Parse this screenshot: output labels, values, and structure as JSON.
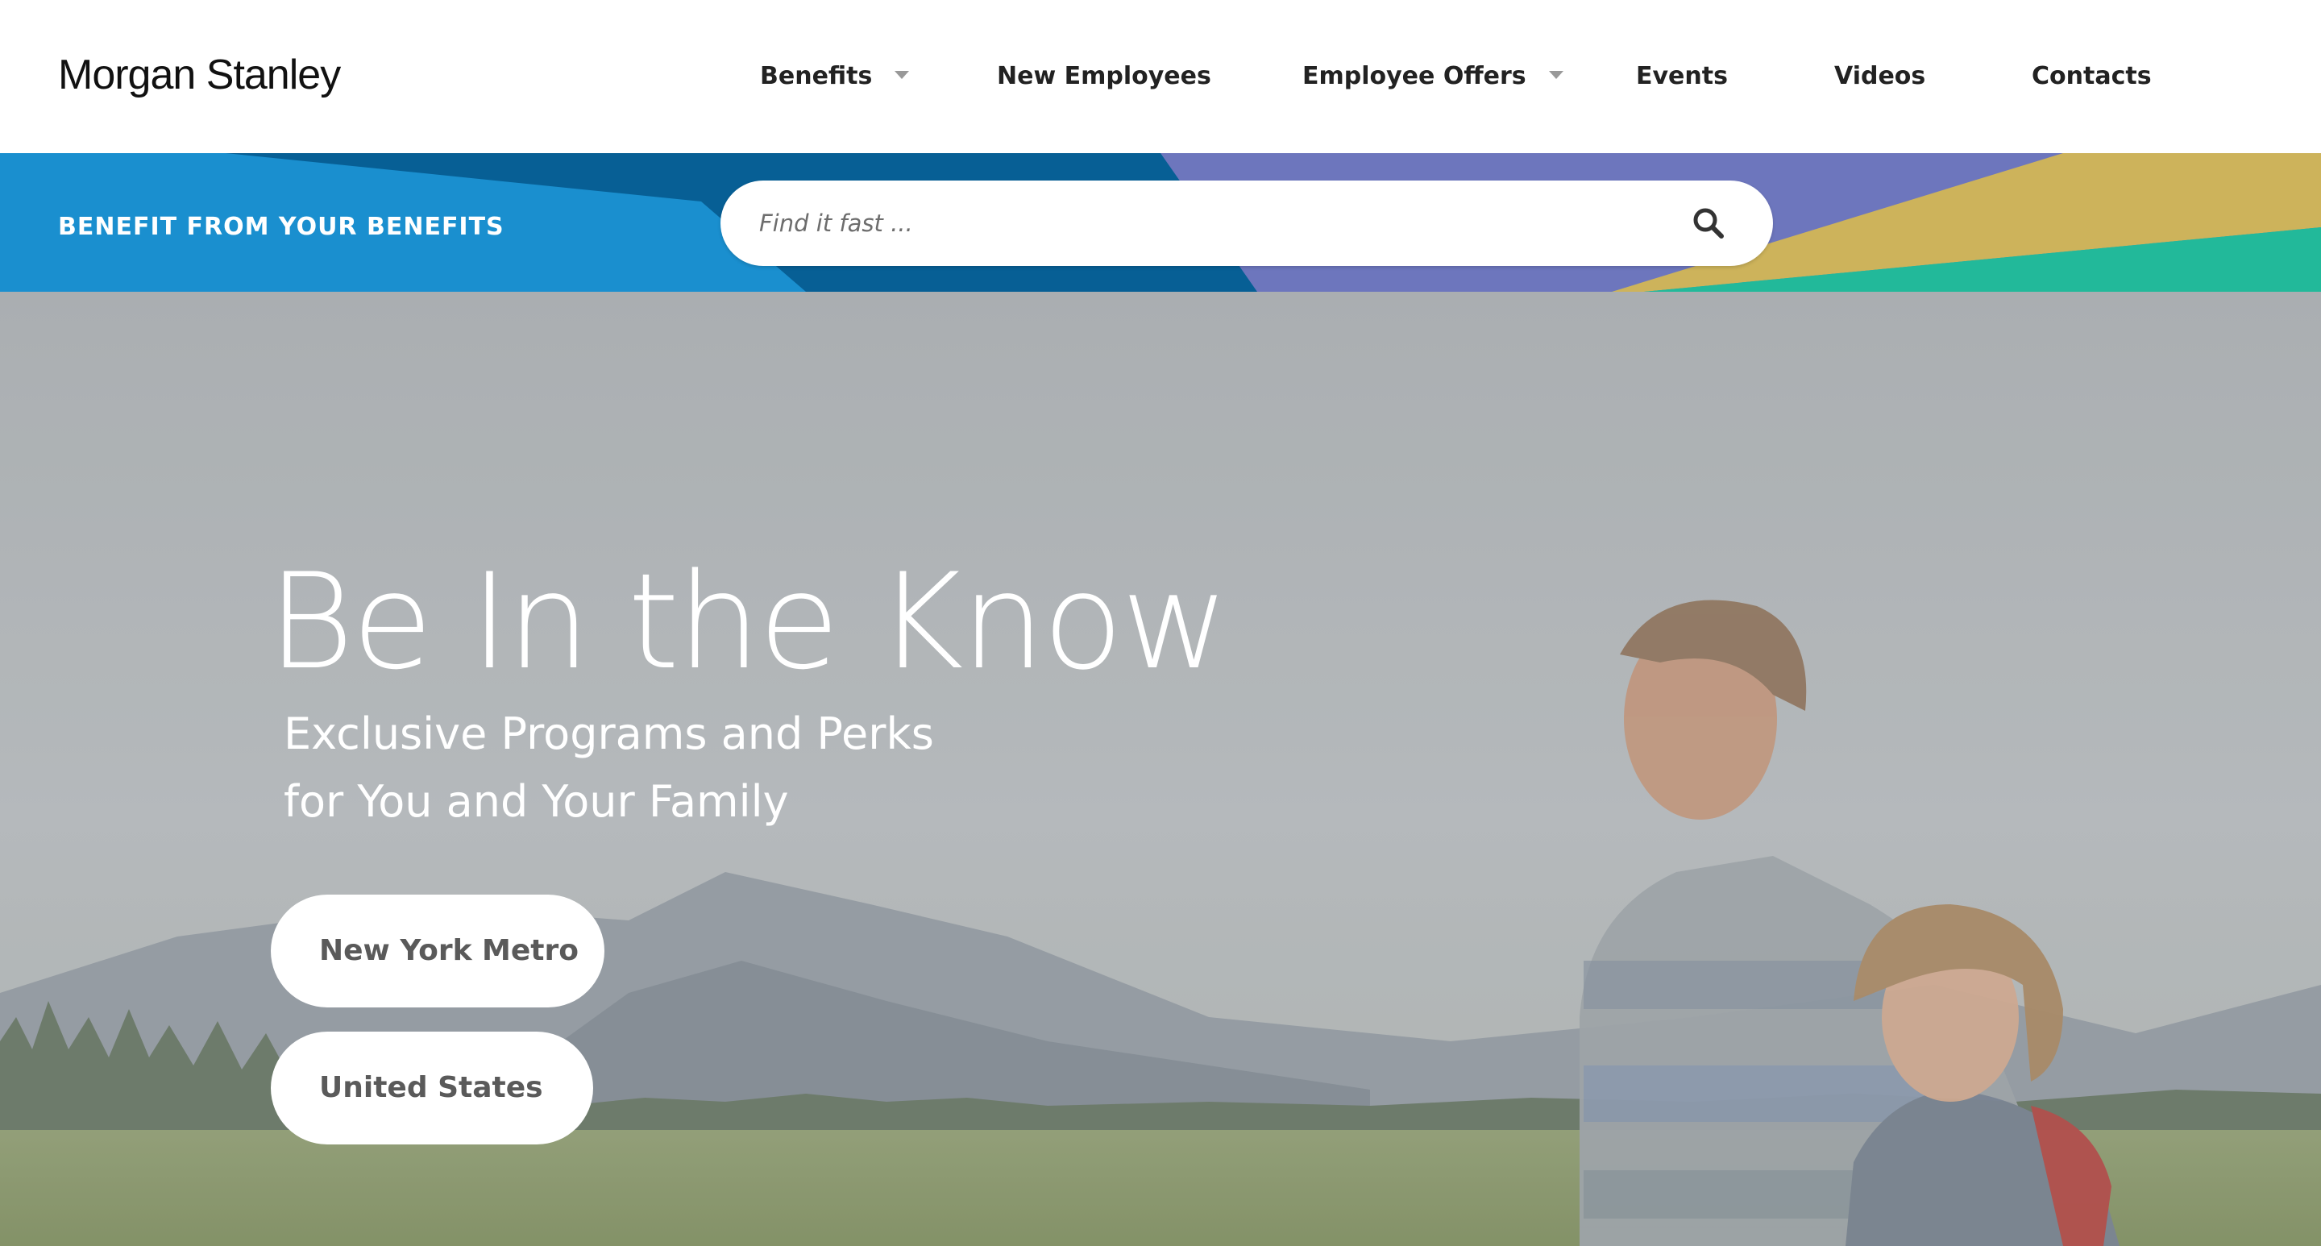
{
  "header": {
    "logo": "Morgan Stanley",
    "nav": [
      {
        "label": "Benefits",
        "has_dropdown": true
      },
      {
        "label": "New Employees",
        "has_dropdown": false
      },
      {
        "label": "Employee Offers",
        "has_dropdown": true
      },
      {
        "label": "Events",
        "has_dropdown": false
      },
      {
        "label": "Videos",
        "has_dropdown": false
      },
      {
        "label": "Contacts",
        "has_dropdown": false
      }
    ]
  },
  "band": {
    "tagline": "BENEFIT FROM YOUR BENEFITS",
    "search": {
      "placeholder": "Find it fast ...",
      "value": "",
      "icon": "search-icon"
    },
    "colors": {
      "blue": "#1a8fcf",
      "dark_blue": "#075f95",
      "purple": "#6d76bd",
      "gold": "#cdb35b",
      "teal": "#22b99a"
    }
  },
  "hero": {
    "title": "Be In the Know",
    "subtitle_line1": "Exclusive Programs and Perks",
    "subtitle_line2": "for You and Your Family",
    "buttons": [
      {
        "label": "New York Metro"
      },
      {
        "label": "United States"
      }
    ]
  }
}
